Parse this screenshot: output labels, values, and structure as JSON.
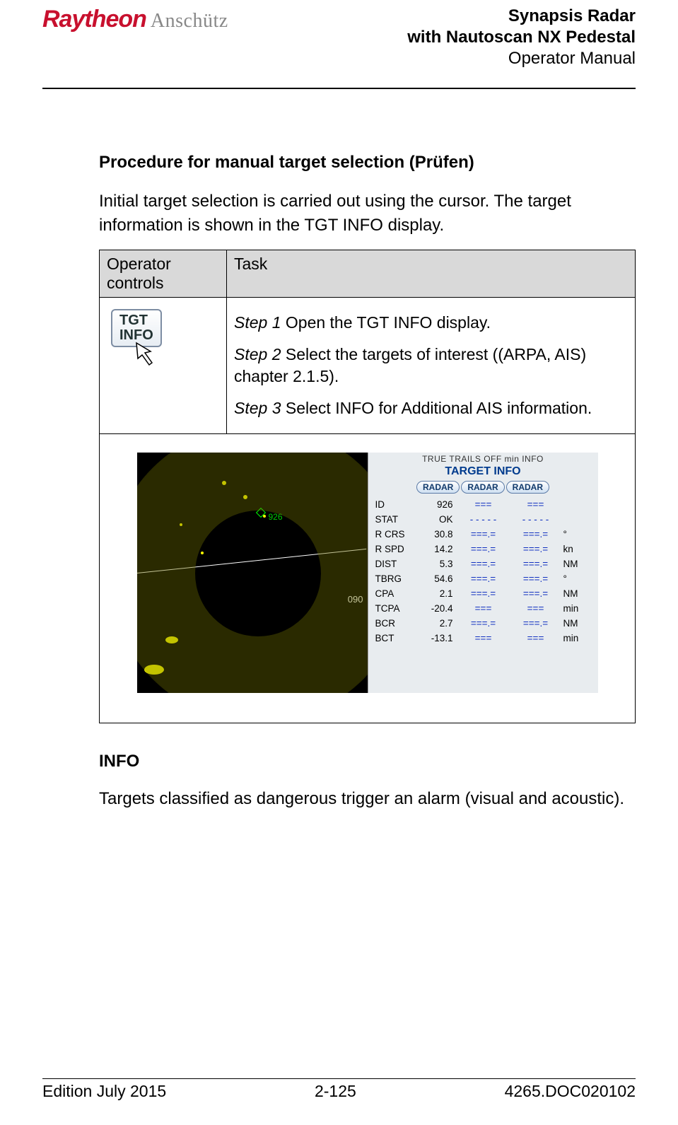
{
  "header": {
    "logo_ray": "Raytheon",
    "logo_ansch": "Anschütz",
    "title_line1": "Synapsis Radar",
    "title_line2": "with Nautoscan NX Pedestal",
    "title_line3": "Operator Manual"
  },
  "section": {
    "title": "Procedure for manual target selection (Prüfen)",
    "intro": "Initial target selection is carried out using the cursor. The target information is shown in the TGT INFO display."
  },
  "table": {
    "col1": "Operator controls",
    "col2": "Task",
    "tgt_btn_line1": "TGT",
    "tgt_btn_line2": "INFO",
    "step1_label": "Step 1",
    "step1_text": " Open the TGT INFO display.",
    "step2_label": "Step 2",
    "step2_text": " Select the targets of interest ((ARPA, AIS) chapter 2.1.5).",
    "step3_label": "Step 3",
    "step3_text": " Select INFO for Additional AIS information."
  },
  "shot": {
    "radar_target_id": "926",
    "bearing_090": "090",
    "top_strip": "TRUE TRAILS   OFF   min   INFO",
    "title": "TARGET INFO",
    "tab": "RADAR",
    "rows": [
      {
        "lbl": "ID",
        "v1": "926",
        "v2": "===",
        "v3": "===",
        "unit": ""
      },
      {
        "lbl": "STAT",
        "v1": "OK",
        "v2": "- - - - -",
        "v3": "- - - - -",
        "unit": ""
      },
      {
        "lbl": "R CRS",
        "v1": "30.8",
        "v2": "===.=",
        "v3": "===.=",
        "unit": "°"
      },
      {
        "lbl": "R SPD",
        "v1": "14.2",
        "v2": "===.=",
        "v3": "===.=",
        "unit": "kn"
      },
      {
        "lbl": "DIST",
        "v1": "5.3",
        "v2": "===.=",
        "v3": "===.=",
        "unit": "NM"
      },
      {
        "lbl": "TBRG",
        "v1": "54.6",
        "v2": "===.=",
        "v3": "===.=",
        "unit": "°"
      },
      {
        "lbl": "CPA",
        "v1": "2.1",
        "v2": "===.=",
        "v3": "===.=",
        "unit": "NM"
      },
      {
        "lbl": "TCPA",
        "v1": "-20.4",
        "v2": "===",
        "v3": "===",
        "unit": "min"
      },
      {
        "lbl": "BCR",
        "v1": "2.7",
        "v2": "===.=",
        "v3": "===.=",
        "unit": "NM"
      },
      {
        "lbl": "BCT",
        "v1": "-13.1",
        "v2": "===",
        "v3": "===",
        "unit": "min"
      }
    ]
  },
  "info_section": {
    "title": "INFO",
    "text": "Targets classified as dangerous trigger an alarm (visual and acoustic)."
  },
  "footer": {
    "left": "Edition July 2015",
    "center": "2-125",
    "right": "4265.DOC020102"
  }
}
